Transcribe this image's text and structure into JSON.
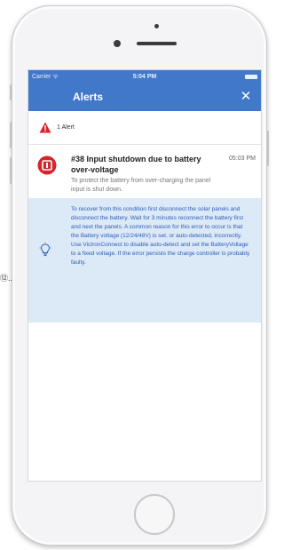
{
  "status_bar": {
    "carrier": "Carrier ᯤ",
    "time": "5:04 PM"
  },
  "nav": {
    "title": "Alerts",
    "close_icon": "close-icon"
  },
  "alerts_summary": {
    "count_text": "1 Alert",
    "icon": "warning-triangle-icon"
  },
  "alert": {
    "icon": "error-stop-icon",
    "title": "#38 Input shutdown due to battery over-voltage",
    "time": "05:03 PM",
    "description": "To protect the battery from over-charging the panel input is shut down."
  },
  "help": {
    "icon": "lightbulb-icon",
    "text": "To recover from this condition first disconnect the solar panels and disconnect the battery. Wait for 3 minutes reconnect the battery first and next the panels. A common reason for this error to occur is that the Battery voltage (12/24/48V) is set, or auto-detected, incorrectly. Use VictronConnect to disable auto-detect and set the BatteryVoltage to a fixed voltage. If the error persists the charge controller is probably faulty."
  },
  "page_fragment": "⑫..",
  "colors": {
    "header_blue": "#4178c9",
    "help_background": "#dce9f7",
    "help_text": "#2f5db8",
    "alert_red": "#d3252c"
  }
}
